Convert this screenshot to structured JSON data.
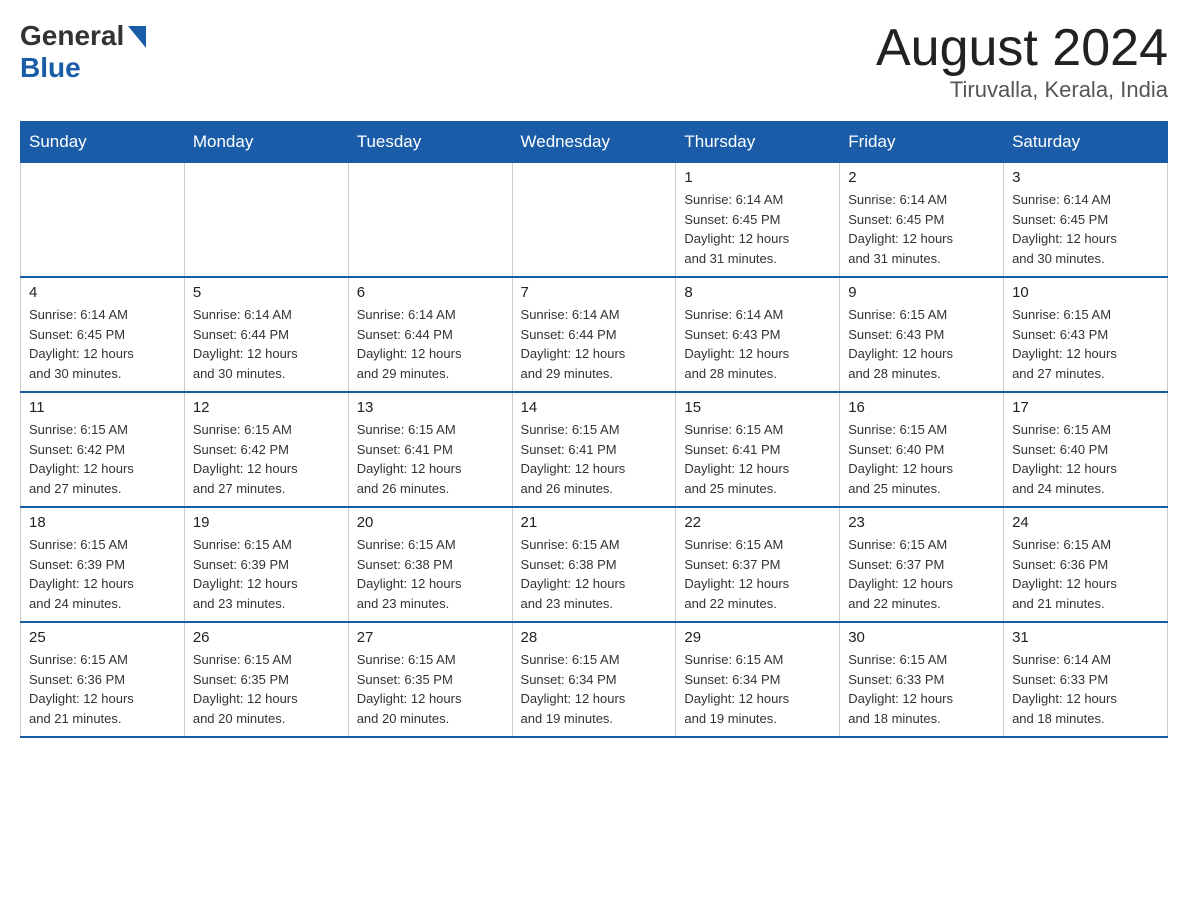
{
  "header": {
    "logo_general": "General",
    "logo_blue": "Blue",
    "title": "August 2024",
    "subtitle": "Tiruvalla, Kerala, India"
  },
  "days_of_week": [
    "Sunday",
    "Monday",
    "Tuesday",
    "Wednesday",
    "Thursday",
    "Friday",
    "Saturday"
  ],
  "weeks": [
    {
      "days": [
        {
          "number": "",
          "info": ""
        },
        {
          "number": "",
          "info": ""
        },
        {
          "number": "",
          "info": ""
        },
        {
          "number": "",
          "info": ""
        },
        {
          "number": "1",
          "info": "Sunrise: 6:14 AM\nSunset: 6:45 PM\nDaylight: 12 hours\nand 31 minutes."
        },
        {
          "number": "2",
          "info": "Sunrise: 6:14 AM\nSunset: 6:45 PM\nDaylight: 12 hours\nand 31 minutes."
        },
        {
          "number": "3",
          "info": "Sunrise: 6:14 AM\nSunset: 6:45 PM\nDaylight: 12 hours\nand 30 minutes."
        }
      ]
    },
    {
      "days": [
        {
          "number": "4",
          "info": "Sunrise: 6:14 AM\nSunset: 6:45 PM\nDaylight: 12 hours\nand 30 minutes."
        },
        {
          "number": "5",
          "info": "Sunrise: 6:14 AM\nSunset: 6:44 PM\nDaylight: 12 hours\nand 30 minutes."
        },
        {
          "number": "6",
          "info": "Sunrise: 6:14 AM\nSunset: 6:44 PM\nDaylight: 12 hours\nand 29 minutes."
        },
        {
          "number": "7",
          "info": "Sunrise: 6:14 AM\nSunset: 6:44 PM\nDaylight: 12 hours\nand 29 minutes."
        },
        {
          "number": "8",
          "info": "Sunrise: 6:14 AM\nSunset: 6:43 PM\nDaylight: 12 hours\nand 28 minutes."
        },
        {
          "number": "9",
          "info": "Sunrise: 6:15 AM\nSunset: 6:43 PM\nDaylight: 12 hours\nand 28 minutes."
        },
        {
          "number": "10",
          "info": "Sunrise: 6:15 AM\nSunset: 6:43 PM\nDaylight: 12 hours\nand 27 minutes."
        }
      ]
    },
    {
      "days": [
        {
          "number": "11",
          "info": "Sunrise: 6:15 AM\nSunset: 6:42 PM\nDaylight: 12 hours\nand 27 minutes."
        },
        {
          "number": "12",
          "info": "Sunrise: 6:15 AM\nSunset: 6:42 PM\nDaylight: 12 hours\nand 27 minutes."
        },
        {
          "number": "13",
          "info": "Sunrise: 6:15 AM\nSunset: 6:41 PM\nDaylight: 12 hours\nand 26 minutes."
        },
        {
          "number": "14",
          "info": "Sunrise: 6:15 AM\nSunset: 6:41 PM\nDaylight: 12 hours\nand 26 minutes."
        },
        {
          "number": "15",
          "info": "Sunrise: 6:15 AM\nSunset: 6:41 PM\nDaylight: 12 hours\nand 25 minutes."
        },
        {
          "number": "16",
          "info": "Sunrise: 6:15 AM\nSunset: 6:40 PM\nDaylight: 12 hours\nand 25 minutes."
        },
        {
          "number": "17",
          "info": "Sunrise: 6:15 AM\nSunset: 6:40 PM\nDaylight: 12 hours\nand 24 minutes."
        }
      ]
    },
    {
      "days": [
        {
          "number": "18",
          "info": "Sunrise: 6:15 AM\nSunset: 6:39 PM\nDaylight: 12 hours\nand 24 minutes."
        },
        {
          "number": "19",
          "info": "Sunrise: 6:15 AM\nSunset: 6:39 PM\nDaylight: 12 hours\nand 23 minutes."
        },
        {
          "number": "20",
          "info": "Sunrise: 6:15 AM\nSunset: 6:38 PM\nDaylight: 12 hours\nand 23 minutes."
        },
        {
          "number": "21",
          "info": "Sunrise: 6:15 AM\nSunset: 6:38 PM\nDaylight: 12 hours\nand 23 minutes."
        },
        {
          "number": "22",
          "info": "Sunrise: 6:15 AM\nSunset: 6:37 PM\nDaylight: 12 hours\nand 22 minutes."
        },
        {
          "number": "23",
          "info": "Sunrise: 6:15 AM\nSunset: 6:37 PM\nDaylight: 12 hours\nand 22 minutes."
        },
        {
          "number": "24",
          "info": "Sunrise: 6:15 AM\nSunset: 6:36 PM\nDaylight: 12 hours\nand 21 minutes."
        }
      ]
    },
    {
      "days": [
        {
          "number": "25",
          "info": "Sunrise: 6:15 AM\nSunset: 6:36 PM\nDaylight: 12 hours\nand 21 minutes."
        },
        {
          "number": "26",
          "info": "Sunrise: 6:15 AM\nSunset: 6:35 PM\nDaylight: 12 hours\nand 20 minutes."
        },
        {
          "number": "27",
          "info": "Sunrise: 6:15 AM\nSunset: 6:35 PM\nDaylight: 12 hours\nand 20 minutes."
        },
        {
          "number": "28",
          "info": "Sunrise: 6:15 AM\nSunset: 6:34 PM\nDaylight: 12 hours\nand 19 minutes."
        },
        {
          "number": "29",
          "info": "Sunrise: 6:15 AM\nSunset: 6:34 PM\nDaylight: 12 hours\nand 19 minutes."
        },
        {
          "number": "30",
          "info": "Sunrise: 6:15 AM\nSunset: 6:33 PM\nDaylight: 12 hours\nand 18 minutes."
        },
        {
          "number": "31",
          "info": "Sunrise: 6:14 AM\nSunset: 6:33 PM\nDaylight: 12 hours\nand 18 minutes."
        }
      ]
    }
  ]
}
